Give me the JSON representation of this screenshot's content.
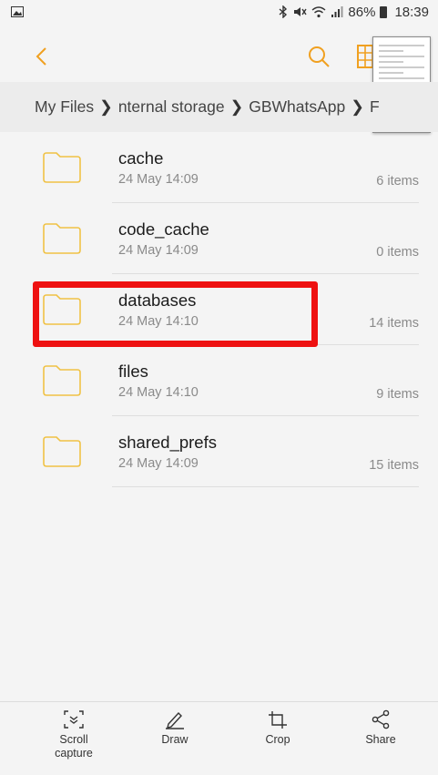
{
  "status_bar": {
    "battery": "86%",
    "time": "18:39",
    "icons": [
      "image-icon",
      "bluetooth-icon",
      "mute-icon",
      "wifi-icon",
      "signal-icon",
      "battery-icon"
    ]
  },
  "toolbar": {
    "icons": [
      "back-icon",
      "search-icon",
      "grid-view-icon"
    ]
  },
  "breadcrumb": {
    "items": [
      "My Files",
      "nternal storage",
      "GBWhatsApp",
      "F"
    ]
  },
  "files": [
    {
      "name": "cache",
      "date": "24 May 14:09",
      "count": "6 items"
    },
    {
      "name": "code_cache",
      "date": "24 May 14:09",
      "count": "0 items"
    },
    {
      "name": "databases",
      "date": "24 May 14:10",
      "count": "14 items"
    },
    {
      "name": "files",
      "date": "24 May 14:10",
      "count": "9 items"
    },
    {
      "name": "shared_prefs",
      "date": "24 May 14:09",
      "count": "15 items"
    }
  ],
  "bottom_bar": {
    "scroll_capture": "Scroll\ncapture",
    "draw": "Draw",
    "crop": "Crop",
    "share": "Share"
  },
  "colors": {
    "folder_outline": "#f0c245",
    "accent": "#f0a020",
    "highlight": "#ee1111"
  }
}
